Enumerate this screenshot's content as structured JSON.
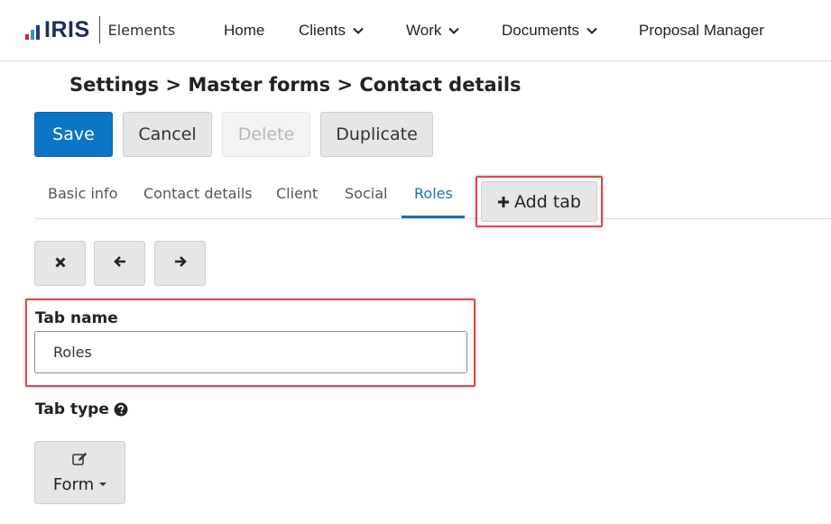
{
  "header": {
    "logo_text": "IRIS",
    "product": "Elements",
    "nav": [
      {
        "label": "Home",
        "has_dropdown": false
      },
      {
        "label": "Clients",
        "has_dropdown": true
      },
      {
        "label": "Work",
        "has_dropdown": true
      },
      {
        "label": "Documents",
        "has_dropdown": true
      },
      {
        "label": "Proposal Manager",
        "has_dropdown": false
      }
    ]
  },
  "breadcrumb": "Settings > Master forms > Contact details",
  "toolbar": {
    "save_label": "Save",
    "cancel_label": "Cancel",
    "delete_label": "Delete",
    "delete_disabled": true,
    "duplicate_label": "Duplicate"
  },
  "tabs": {
    "items": [
      {
        "label": "Basic info",
        "active": false
      },
      {
        "label": "Contact details",
        "active": false
      },
      {
        "label": "Client",
        "active": false
      },
      {
        "label": "Social",
        "active": false
      },
      {
        "label": "Roles",
        "active": true
      }
    ],
    "add_label": "Add tab"
  },
  "tab_tools": [
    {
      "icon": "close-icon"
    },
    {
      "icon": "arrow-left-icon"
    },
    {
      "icon": "arrow-right-icon"
    }
  ],
  "tab_name": {
    "label": "Tab name",
    "value": "Roles"
  },
  "tab_type": {
    "label": "Tab type",
    "help_icon": "question-circle-icon",
    "selected": "Form",
    "selected_icon": "edit-icon"
  },
  "colors": {
    "primary": "#0b76c5",
    "active_tab": "#1f6fb8",
    "highlight": "#e4474c",
    "logo_red": "#e0201b",
    "logo_blue": "#3c8ad8",
    "logo_navy": "#1c3f78"
  }
}
